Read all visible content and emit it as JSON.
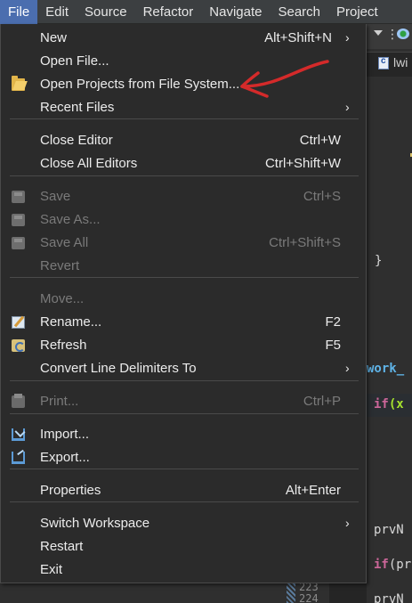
{
  "menubar": {
    "items": [
      "File",
      "Edit",
      "Source",
      "Refactor",
      "Navigate",
      "Search",
      "Project"
    ]
  },
  "editor": {
    "tab_label": "lwi",
    "code": {
      "brace": "}",
      "ident": "work_",
      "if1_kw": "if",
      "if1_rest": "(x",
      "prv1": "prvN",
      "if2_kw": "if",
      "if2_rest": "(pr",
      "prv2": "prvN"
    },
    "line_numbers": [
      "223",
      "224"
    ]
  },
  "file_menu": {
    "items": [
      {
        "label": "New",
        "accel": "Alt+Shift+N",
        "submenu": true,
        "disabled": false,
        "icon": ""
      },
      {
        "label": "Open File...",
        "accel": "",
        "submenu": false,
        "disabled": false,
        "icon": ""
      },
      {
        "label": "Open Projects from File System...",
        "accel": "",
        "submenu": false,
        "disabled": false,
        "icon": "folder-icon"
      },
      {
        "label": "Recent Files",
        "accel": "",
        "submenu": true,
        "disabled": false,
        "icon": ""
      },
      {
        "label": "Close Editor",
        "accel": "Ctrl+W",
        "submenu": false,
        "disabled": false,
        "icon": ""
      },
      {
        "label": "Close All Editors",
        "accel": "Ctrl+Shift+W",
        "submenu": false,
        "disabled": false,
        "icon": ""
      },
      {
        "label": "Save",
        "accel": "Ctrl+S",
        "submenu": false,
        "disabled": true,
        "icon": "save-icon"
      },
      {
        "label": "Save As...",
        "accel": "",
        "submenu": false,
        "disabled": true,
        "icon": "save-as-icon"
      },
      {
        "label": "Save All",
        "accel": "Ctrl+Shift+S",
        "submenu": false,
        "disabled": true,
        "icon": "save-all-icon"
      },
      {
        "label": "Revert",
        "accel": "",
        "submenu": false,
        "disabled": true,
        "icon": ""
      },
      {
        "label": "Move...",
        "accel": "",
        "submenu": false,
        "disabled": true,
        "icon": ""
      },
      {
        "label": "Rename...",
        "accel": "F2",
        "submenu": false,
        "disabled": false,
        "icon": "rename-icon"
      },
      {
        "label": "Refresh",
        "accel": "F5",
        "submenu": false,
        "disabled": false,
        "icon": "refresh-icon"
      },
      {
        "label": "Convert Line Delimiters To",
        "accel": "",
        "submenu": true,
        "disabled": false,
        "icon": ""
      },
      {
        "label": "Print...",
        "accel": "Ctrl+P",
        "submenu": false,
        "disabled": true,
        "icon": "print-icon"
      },
      {
        "label": "Import...",
        "accel": "",
        "submenu": false,
        "disabled": false,
        "icon": "import-icon"
      },
      {
        "label": "Export...",
        "accel": "",
        "submenu": false,
        "disabled": false,
        "icon": "export-icon"
      },
      {
        "label": "Properties",
        "accel": "Alt+Enter",
        "submenu": false,
        "disabled": false,
        "icon": ""
      },
      {
        "label": "Switch Workspace",
        "accel": "",
        "submenu": true,
        "disabled": false,
        "icon": ""
      },
      {
        "label": "Restart",
        "accel": "",
        "submenu": false,
        "disabled": false,
        "icon": ""
      },
      {
        "label": "Exit",
        "accel": "",
        "submenu": false,
        "disabled": false,
        "icon": ""
      }
    ],
    "submenu_glyph": "›"
  },
  "colors": {
    "active_menu": "#4b6eaf",
    "annotation_arrow": "#d42a2a",
    "disabled_text": "#7a7a7a"
  }
}
